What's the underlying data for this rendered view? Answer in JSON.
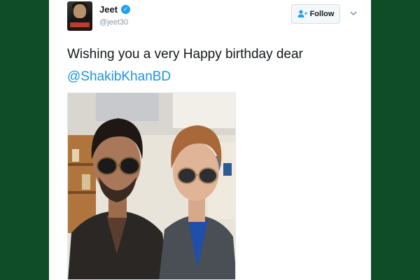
{
  "tweet": {
    "author_name": "Jeet",
    "author_handle": "@jeet30",
    "verified": true,
    "follow_label": "Follow",
    "text_line1": "Wishing you a very Happy birthday dear",
    "mention": "@ShakibKhanBD"
  },
  "icons": {
    "verified": "verified-badge-icon",
    "follow": "add-user-icon",
    "menu": "chevron-down-icon"
  },
  "colors": {
    "background": "#0f4d28",
    "card": "#ffffff",
    "link": "#1b95e0",
    "verified": "#1da1f2"
  }
}
